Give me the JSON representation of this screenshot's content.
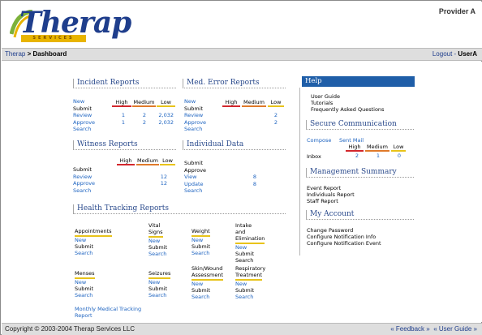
{
  "header": {
    "logo_text": "Therap",
    "logo_sub": "SERVICES",
    "provider": "Provider A"
  },
  "nav": {
    "crumb_home": "Therap",
    "crumb_sep": " > ",
    "crumb_current": "Dashboard",
    "logout": "Logout",
    "sep": " - ",
    "user": "UserA"
  },
  "incident": {
    "title": "Incident Reports",
    "high": "High",
    "medium": "Medium",
    "low": "Low",
    "new": "New",
    "submit": "Submit",
    "review": "Review",
    "approve": "Approve",
    "search": "Search",
    "review_high": "1",
    "review_med": "2",
    "review_low": "2,032",
    "approve_high": "1",
    "approve_med": "2",
    "approve_low": "2,032"
  },
  "mederr": {
    "title": "Med. Error Reports",
    "high": "High",
    "medium": "Medium",
    "low": "Low",
    "new": "New",
    "submit": "Submit",
    "review": "Review",
    "approve": "Approve",
    "search": "Search",
    "review_low": "2",
    "approve_low": "2"
  },
  "witness": {
    "title": "Witness Reports",
    "high": "High",
    "medium": "Medium",
    "low": "Low",
    "submit": "Submit",
    "review": "Review",
    "approve": "Approve",
    "search": "Search",
    "review_low": "12",
    "approve_low": "12"
  },
  "individual": {
    "title": "Individual Data",
    "submit": "Submit",
    "approve": "Approve",
    "view": "View",
    "update": "Update",
    "search": "Search",
    "view_n": "8",
    "update_n": "8"
  },
  "health": {
    "title": "Health Tracking Reports",
    "appointments": "Appointments",
    "vital1": "Vital",
    "vital2": "Signs",
    "weight": "Weight",
    "intake1": "Intake",
    "intake2": "and",
    "intake3": "Elimination",
    "menses": "Menses",
    "seizures": "Seizures",
    "skin1": "Skin/Wound",
    "skin2": "Assessment",
    "resp1": "Respiratory",
    "resp2": "Treatment",
    "new": "New",
    "submit": "Submit",
    "search": "Search",
    "monthly1": "Monthly Medical Tracking",
    "monthly2": "Report"
  },
  "help": {
    "title": "Help",
    "items": [
      "User Guide",
      "Tutorials",
      "Frequently Asked Questions"
    ]
  },
  "secure": {
    "title": "Secure Communication",
    "compose": "Compose",
    "sent": "Sent Mail",
    "high": "High",
    "medium": "Medium",
    "low": "Low",
    "inbox": "Inbox",
    "inbox_high": "2",
    "inbox_med": "1",
    "inbox_low": "0"
  },
  "mgmt": {
    "title": "Management Summary",
    "items": [
      "Event Report",
      "Individuals Report",
      "Staff Report"
    ]
  },
  "account": {
    "title": "My Account",
    "items": [
      "Change Password",
      "Configure Notification Info",
      "Configure Notification Event"
    ]
  },
  "footer": {
    "copyright": "Copyright © 2003-2004 Therap Services LLC",
    "feedback": "« Feedback »",
    "user_guide": "« User Guide »"
  },
  "colors": {
    "brand_blue": "#1f3e8c",
    "help_bar": "#1f5ea8",
    "high": "#d3272c",
    "medium": "#e07a2a",
    "low": "#e8c31a"
  }
}
